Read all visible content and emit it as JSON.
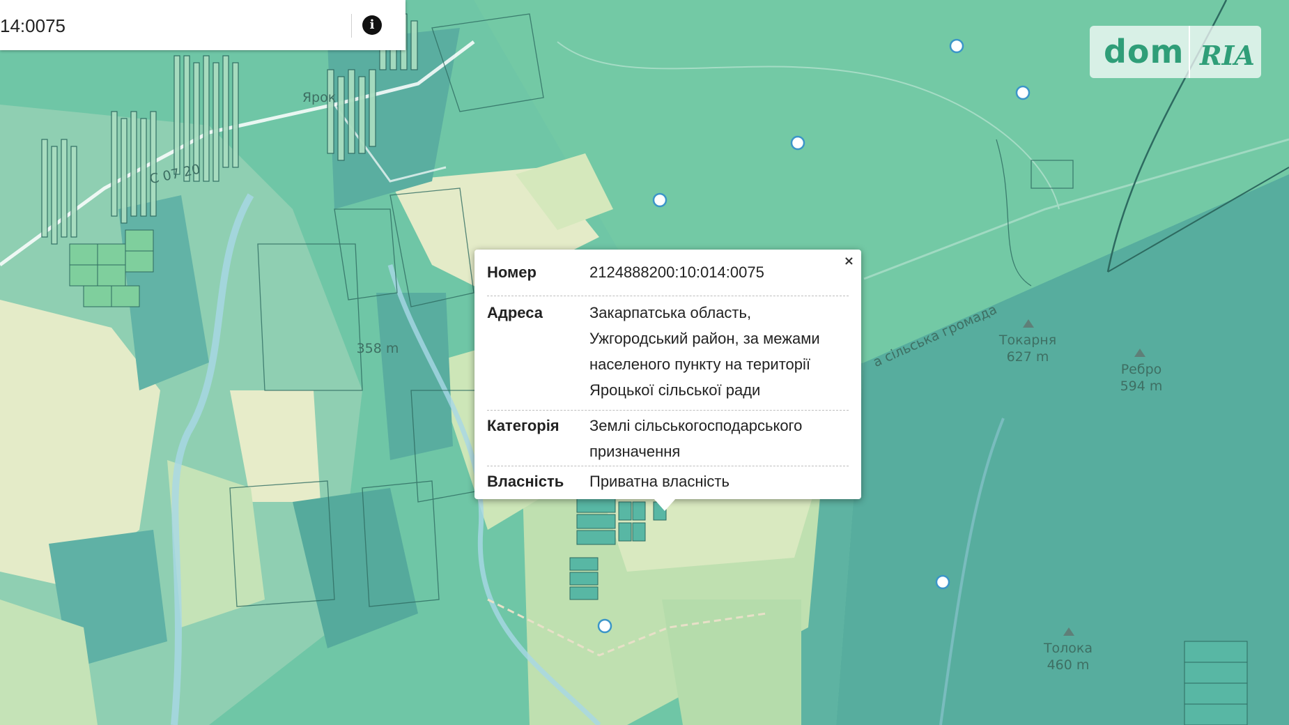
{
  "search": {
    "value": "14:0075"
  },
  "logo": {
    "left": "dom",
    "right": "RIA"
  },
  "popup": {
    "close": "×",
    "rows": [
      {
        "label": "Номер",
        "lines": [
          "2124888200:10:014:0075"
        ]
      },
      {
        "label": "Адреса",
        "lines": [
          "Закарпатська область,",
          "Ужгородський район, за межами",
          "населеного пункту на території",
          "Яроцької сільської ради"
        ]
      },
      {
        "label": "Категорія",
        "lines": [
          "Землі сільськогосподарського",
          "призначення"
        ]
      },
      {
        "label": "Власність",
        "lines": [
          "Приватна власність"
        ]
      }
    ]
  },
  "map_labels": {
    "peak_tokarnia": "Токарня",
    "peak_tokarnia_elev": "627 m",
    "peak_rebro": "Ребро",
    "peak_rebro_elev": "594 m",
    "peak_toloka": "Толока",
    "peak_toloka_elev": "460 m",
    "elev_358": "358 m",
    "road_label": "а сільська громада",
    "village": "Ярок",
    "road_code": "С 07 20"
  },
  "colors": {
    "forest_dark": "#52aa9a",
    "forest_light": "#6fc6a6",
    "field": "#a9d6a8",
    "meadow": "#e7ecc9",
    "parcel_stroke": "#2d6a60"
  }
}
